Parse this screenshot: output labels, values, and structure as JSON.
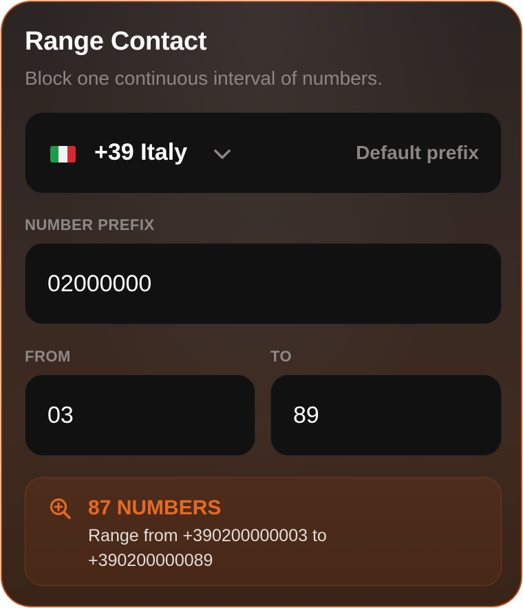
{
  "header": {
    "title": "Range Contact",
    "subtitle": "Block one continuous interval of numbers."
  },
  "country": {
    "flag": "italy-flag",
    "label": "+39 Italy",
    "default_label": "Default prefix"
  },
  "prefix": {
    "label": "NUMBER PREFIX",
    "value": "02000000"
  },
  "range": {
    "from_label": "FROM",
    "from_value": "03",
    "to_label": "TO",
    "to_value": "89"
  },
  "summary": {
    "icon": "zoom-in-icon",
    "count": "87 NUMBERS",
    "text": "Range from +390200000003 to +390200000089"
  },
  "colors": {
    "accent": "#e56a22",
    "border": "#c2561c",
    "field_bg": "#131213"
  }
}
